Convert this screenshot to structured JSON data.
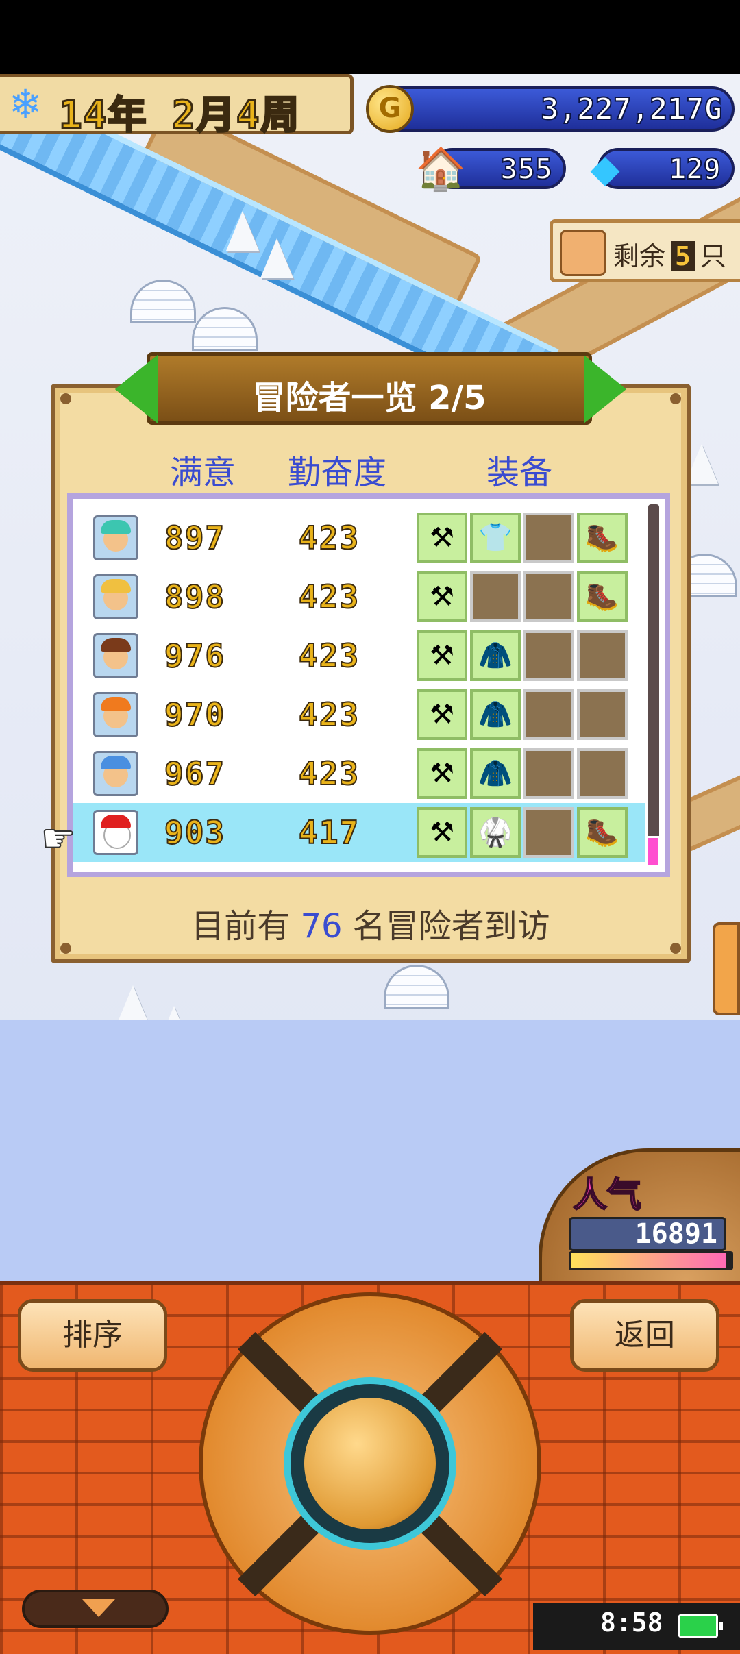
{
  "hud": {
    "date": "14年 2月4周",
    "gold": "3,227,217G",
    "gold_coin_letter": "G",
    "population": "355",
    "crystals": "129",
    "remaining_label": "剩余",
    "remaining_count": "5",
    "remaining_unit": "只"
  },
  "panel": {
    "title": "冒险者一览 2/5",
    "col_satisfaction": "满意",
    "col_diligence": "勤奋度",
    "col_equipment": "装备",
    "rows": [
      {
        "satisfaction": "897",
        "diligence": "423",
        "equip": [
          "axe",
          "armor-light",
          "empty",
          "boots"
        ]
      },
      {
        "satisfaction": "898",
        "diligence": "423",
        "equip": [
          "axe",
          "empty",
          "empty",
          "boots"
        ]
      },
      {
        "satisfaction": "976",
        "diligence": "423",
        "equip": [
          "axe",
          "armor-leather",
          "empty",
          "empty"
        ]
      },
      {
        "satisfaction": "970",
        "diligence": "423",
        "equip": [
          "axe",
          "armor-leather",
          "empty",
          "empty"
        ]
      },
      {
        "satisfaction": "967",
        "diligence": "423",
        "equip": [
          "axe",
          "armor-leather",
          "empty",
          "empty"
        ]
      },
      {
        "satisfaction": "903",
        "diligence": "417",
        "equip": [
          "axe",
          "armor-green",
          "empty",
          "boots"
        ]
      }
    ],
    "footer_prefix": "目前有",
    "footer_count": "76",
    "footer_suffix": "名冒险者到访"
  },
  "popularity": {
    "label": "人气",
    "value": "16891",
    "bar_fraction": 0.97
  },
  "bottom": {
    "sort_button": "排序",
    "back_button": "返回"
  },
  "status": {
    "time": "8:58"
  },
  "colors": {
    "title_banner": "#8a5a1e",
    "header_text": "#3a4cd0",
    "selected_row": "#9ae6f8",
    "brick": "#e35a1e"
  }
}
